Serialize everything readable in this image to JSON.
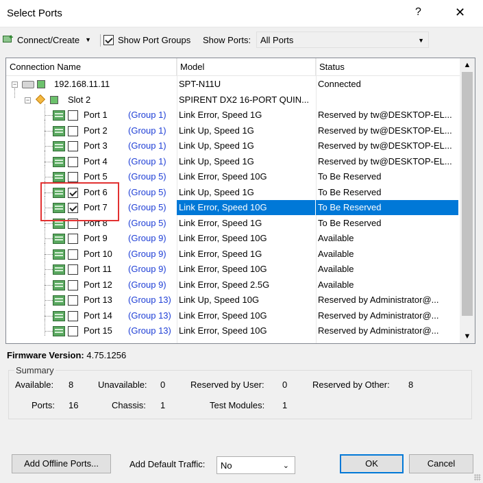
{
  "window": {
    "title": "Select Ports",
    "help": "?",
    "close": "✕"
  },
  "toolbar": {
    "connect_label": "Connect/Create",
    "show_groups_label": "Show Port Groups",
    "show_groups_checked": true,
    "show_ports_label": "Show Ports:",
    "show_ports_value": "All Ports"
  },
  "grid": {
    "headers": {
      "name": "Connection Name",
      "model": "Model",
      "status": "Status"
    },
    "chassis": {
      "name": "192.168.11.11",
      "model": "SPT-N11U",
      "status": "Connected"
    },
    "slot": {
      "name": "Slot 2",
      "model": "SPIRENT DX2 16-PORT QUIN...",
      "status": ""
    },
    "ports": [
      {
        "name": "Port 1",
        "group": "(Group 1)",
        "model": "Link Error, Speed 1G",
        "status": "Reserved by tw@DESKTOP-EL...",
        "checked": false
      },
      {
        "name": "Port 2",
        "group": "(Group 1)",
        "model": "Link Up, Speed 1G",
        "status": "Reserved by tw@DESKTOP-EL...",
        "checked": false
      },
      {
        "name": "Port 3",
        "group": "(Group 1)",
        "model": "Link Up, Speed 1G",
        "status": "Reserved by tw@DESKTOP-EL...",
        "checked": false
      },
      {
        "name": "Port 4",
        "group": "(Group 1)",
        "model": "Link Up, Speed 1G",
        "status": "Reserved by tw@DESKTOP-EL...",
        "checked": false
      },
      {
        "name": "Port 5",
        "group": "(Group 5)",
        "model": "Link Error, Speed 10G",
        "status": "To Be Reserved",
        "checked": false
      },
      {
        "name": "Port 6",
        "group": "(Group 5)",
        "model": "Link Up, Speed 1G",
        "status": "To Be Reserved",
        "checked": true
      },
      {
        "name": "Port 7",
        "group": "(Group 5)",
        "model": "Link Error, Speed 10G",
        "status": "To Be Reserved",
        "checked": true
      },
      {
        "name": "Port 8",
        "group": "(Group 5)",
        "model": "Link Error, Speed 1G",
        "status": "To Be Reserved",
        "checked": false
      },
      {
        "name": "Port 9",
        "group": "(Group 9)",
        "model": "Link Error, Speed 10G",
        "status": "Available",
        "checked": false
      },
      {
        "name": "Port 10",
        "group": "(Group 9)",
        "model": "Link Error, Speed 1G",
        "status": "Available",
        "checked": false
      },
      {
        "name": "Port 11",
        "group": "(Group 9)",
        "model": "Link Error, Speed 10G",
        "status": "Available",
        "checked": false
      },
      {
        "name": "Port 12",
        "group": "(Group 9)",
        "model": "Link Error, Speed 2.5G",
        "status": "Available",
        "checked": false
      },
      {
        "name": "Port 13",
        "group": "(Group 13)",
        "model": "Link Up, Speed 10G",
        "status": "Reserved by Administrator@...",
        "checked": false
      },
      {
        "name": "Port 14",
        "group": "(Group 13)",
        "model": "Link Error, Speed 10G",
        "status": "Reserved by Administrator@...",
        "checked": false
      },
      {
        "name": "Port 15",
        "group": "(Group 13)",
        "model": "Link Error, Speed 10G",
        "status": "Reserved by Administrator@...",
        "checked": false
      }
    ],
    "selected_port": "Port 7"
  },
  "firmware": {
    "label": "Firmware Version:",
    "value": "4.75.1256"
  },
  "summary": {
    "title": "Summary",
    "available_label": "Available:",
    "available": "8",
    "unavailable_label": "Unavailable:",
    "unavailable": "0",
    "reserved_user_label": "Reserved by User:",
    "reserved_user": "0",
    "reserved_other_label": "Reserved by Other:",
    "reserved_other": "8",
    "ports_label": "Ports:",
    "ports": "16",
    "chassis_label": "Chassis:",
    "chassis": "1",
    "modules_label": "Test Modules:",
    "modules": "1"
  },
  "footer": {
    "add_offline_label": "Add Offline Ports...",
    "add_default_traffic_label": "Add Default Traffic:",
    "add_default_traffic_value": "No",
    "ok_label": "OK",
    "cancel_label": "Cancel"
  },
  "colors": {
    "selection": "#0078d7",
    "group_link": "#1f3fd6",
    "highlight_box": "#e23030"
  }
}
